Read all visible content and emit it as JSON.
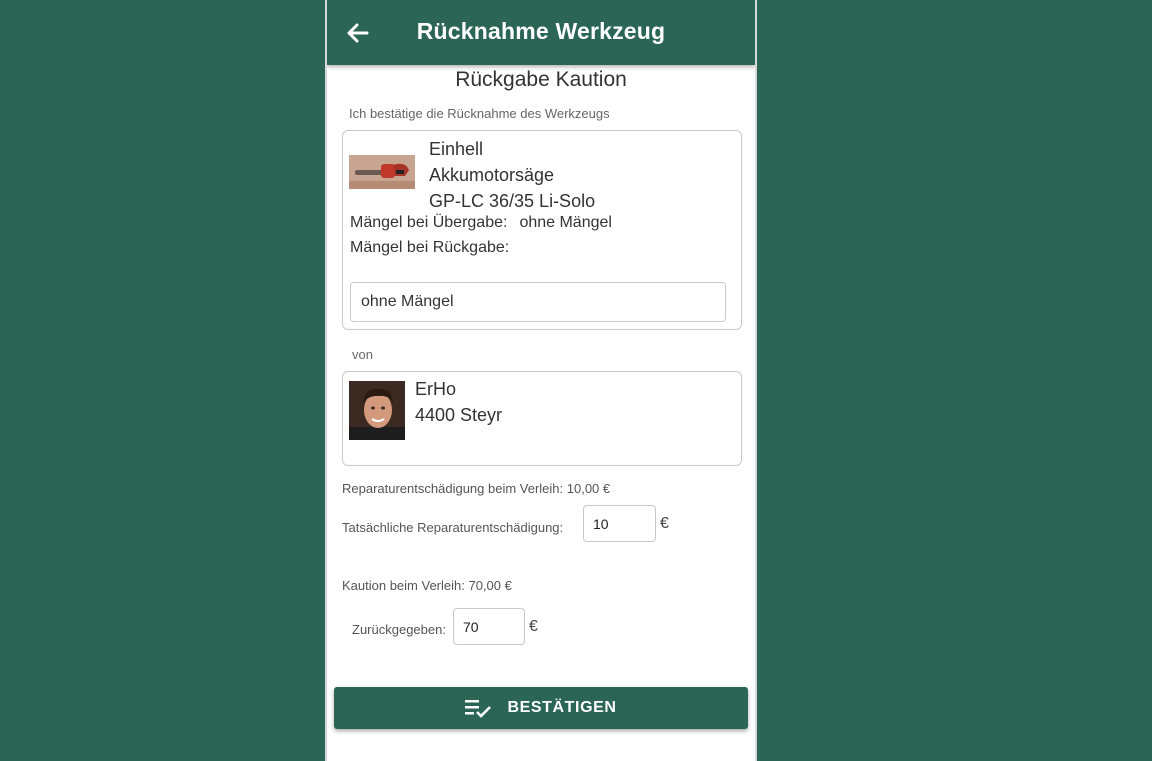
{
  "header": {
    "title": "Rücknahme Werkzeug",
    "back_icon": "arrow-left-icon"
  },
  "section_title": "Rückgabe Kaution",
  "confirm_text": "Ich bestätige die Rücknahme des Werkzeugs",
  "tool": {
    "brand": "Einhell",
    "name": "Akkumotorsäge",
    "model": "GP-LC 36/35 Li-Solo",
    "defects_handover_label": "Mängel bei Übergabe:",
    "defects_handover_value": "ohne Mängel",
    "defects_return_label": "Mängel bei Rückgabe:",
    "defects_return_input_value": "ohne Mängel"
  },
  "from_label": "von",
  "user": {
    "name": "ErHo",
    "location": "4400 Steyr"
  },
  "repair": {
    "info": "Reparaturentschädigung beim Verleih: 10,00 €",
    "actual_label": "Tatsächliche Reparaturentschädigung:",
    "actual_value": "10",
    "currency": "€"
  },
  "deposit": {
    "info": "Kaution beim Verleih: 70,00 €",
    "returned_label": "Zurückgegeben:",
    "returned_value": "70",
    "currency": "€"
  },
  "confirm_button": {
    "label": "BESTÄTIGEN",
    "icon": "playlist-check-icon"
  },
  "colors": {
    "primary": "#2a6555",
    "background": "#2a6555",
    "text": "#333333"
  }
}
